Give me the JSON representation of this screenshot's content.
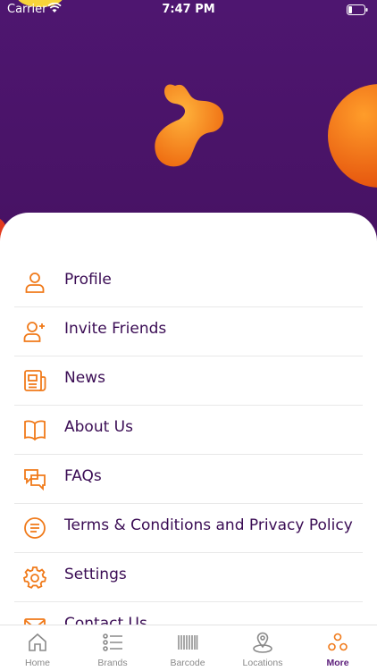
{
  "status_bar": {
    "carrier": "Carrier",
    "time": "7:47 PM"
  },
  "menu": {
    "items": [
      {
        "label": "Profile",
        "icon": "person-icon"
      },
      {
        "label": "Invite Friends",
        "icon": "person-add-icon"
      },
      {
        "label": "News",
        "icon": "newspaper-icon"
      },
      {
        "label": "About Us",
        "icon": "book-icon"
      },
      {
        "label": "FAQs",
        "icon": "chat-bubbles-icon"
      },
      {
        "label": "Terms & Conditions and Privacy Policy",
        "icon": "document-list-icon"
      },
      {
        "label": "Settings",
        "icon": "gear-icon"
      },
      {
        "label": "Contact Us",
        "icon": "mail-icon"
      }
    ]
  },
  "tabbar": {
    "tabs": [
      {
        "label": "Home",
        "icon": "home-icon"
      },
      {
        "label": "Brands",
        "icon": "list-icon"
      },
      {
        "label": "Barcode",
        "icon": "barcode-icon"
      },
      {
        "label": "Locations",
        "icon": "map-pin-icon"
      },
      {
        "label": "More",
        "icon": "more-dots-icon",
        "active": true
      }
    ]
  },
  "colors": {
    "header_purple": "#4a1465",
    "accent_orange": "#f07a1a",
    "text_purple": "#3a0c54",
    "active_tab": "#5b1c7a"
  }
}
